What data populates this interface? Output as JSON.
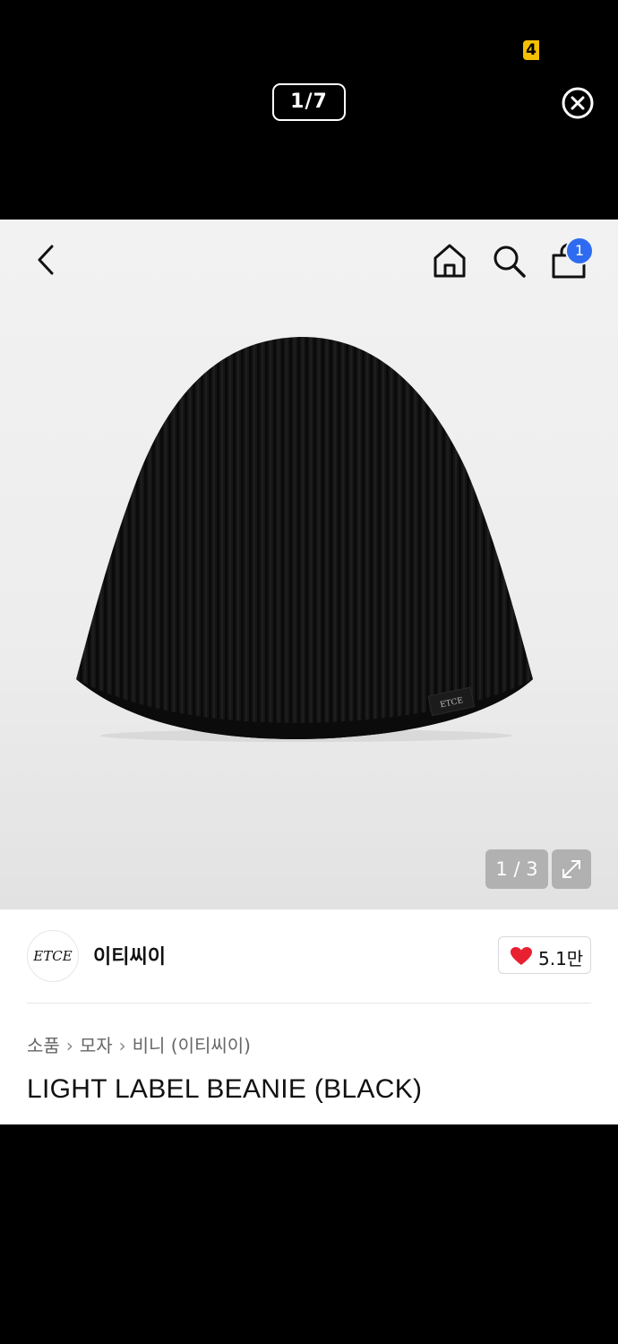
{
  "viewer": {
    "status_badge": "4",
    "counter": "1/7",
    "close_icon": "close-circle-icon"
  },
  "header": {
    "back_icon": "chevron-left-icon",
    "home_icon": "home-icon",
    "search_icon": "search-icon",
    "bag_icon": "shopping-bag-icon",
    "cart_count": "1"
  },
  "gallery": {
    "image_counter": "1 / 3",
    "product_image_label": "ETCE",
    "expand_icon": "expand-icon"
  },
  "brand": {
    "logo_text": "ETCE",
    "name": "이티씨이",
    "likes": "5.1만",
    "heart_icon": "heart-icon"
  },
  "breadcrumb": {
    "items": [
      "소품",
      "모자",
      "비니 (이티씨이)"
    ],
    "separator": "›"
  },
  "product": {
    "title": "LIGHT LABEL BEANIE (BLACK)"
  },
  "colors": {
    "cart_badge": "#2e6bf0",
    "heart": "#e8202f",
    "status_badge": "#f5c000"
  }
}
